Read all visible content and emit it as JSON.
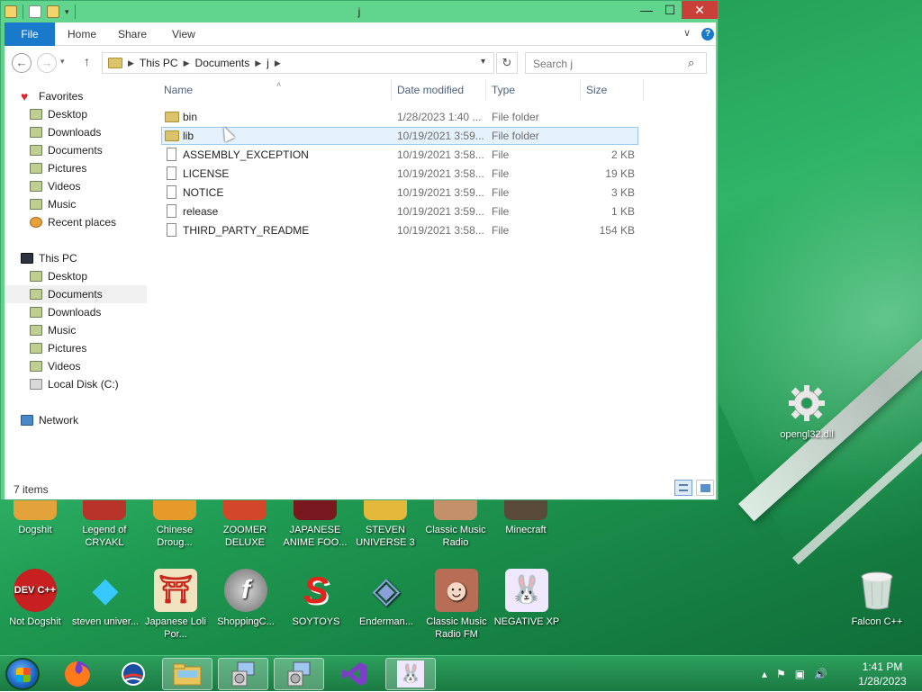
{
  "window": {
    "title": "j",
    "buttons": {
      "minimize": "—",
      "maximize": "☐",
      "close": "✕"
    }
  },
  "ribbon": {
    "tabs": [
      {
        "label": "File"
      },
      {
        "label": "Home"
      },
      {
        "label": "Share"
      },
      {
        "label": "View"
      }
    ],
    "help": "?",
    "collapse": "∨"
  },
  "nav": {
    "back": "←",
    "forward": "→",
    "recent": "▾",
    "up": "↑",
    "address": [
      "This PC",
      "Documents",
      "j"
    ],
    "dropdown": "▾",
    "refresh": "↻",
    "search_placeholder": "Search j",
    "search_icon": "⌕"
  },
  "sidebar": {
    "favorites": {
      "header": "Favorites",
      "items": [
        "Desktop",
        "Downloads",
        "Documents",
        "Pictures",
        "Videos",
        "Music",
        "Recent places"
      ]
    },
    "thispc": {
      "header": "This PC",
      "items": [
        "Desktop",
        "Documents",
        "Downloads",
        "Music",
        "Pictures",
        "Videos",
        "Local Disk (C:)"
      ]
    },
    "network": {
      "header": "Network"
    }
  },
  "columns": [
    "Name",
    "Date modified",
    "Type",
    "Size"
  ],
  "sort_arrow": "˄",
  "files": [
    {
      "name": "bin",
      "date": "1/28/2023 1:40 ...",
      "type": "File folder",
      "size": ""
    },
    {
      "name": "lib",
      "date": "10/19/2021 3:59...",
      "type": "File folder",
      "size": ""
    },
    {
      "name": "ASSEMBLY_EXCEPTION",
      "date": "10/19/2021 3:58...",
      "type": "File",
      "size": "2 KB"
    },
    {
      "name": "LICENSE",
      "date": "10/19/2021 3:58...",
      "type": "File",
      "size": "19 KB"
    },
    {
      "name": "NOTICE",
      "date": "10/19/2021 3:59...",
      "type": "File",
      "size": "3 KB"
    },
    {
      "name": "release",
      "date": "10/19/2021 3:59...",
      "type": "File",
      "size": "1 KB"
    },
    {
      "name": "THIRD_PARTY_README",
      "date": "10/19/2021 3:58...",
      "type": "File",
      "size": "154 KB"
    }
  ],
  "status": {
    "count": "7 items"
  },
  "desktop_icons": {
    "row1": [
      {
        "label": "Dogshit"
      },
      {
        "label": "Legend of CRYAKL"
      },
      {
        "label": "Chinese Droug..."
      },
      {
        "label": "ZOOMER DELUXE"
      },
      {
        "label": "JAPANESE ANIME FOO..."
      },
      {
        "label": "STEVEN UNIVERSE 3"
      },
      {
        "label": "Classic Music Radio"
      },
      {
        "label": "Minecraft"
      }
    ],
    "row2": [
      {
        "label": "Not Dogshit",
        "glyph": "DEV C++"
      },
      {
        "label": "steven univer...",
        "glyph": "◆"
      },
      {
        "label": "Japanese Loli Por...",
        "glyph": "⛩"
      },
      {
        "label": "ShoppingC...",
        "glyph": "f"
      },
      {
        "label": "SOYTOYS",
        "glyph": "S"
      },
      {
        "label": "Enderman...",
        "glyph": "◈"
      },
      {
        "label": "Classic Music Radio FM",
        "glyph": "☻"
      },
      {
        "label": "NEGATIVE XP",
        "glyph": "🐰"
      }
    ],
    "opengl": "opengl32.dll",
    "falcon": "Falcon C++"
  },
  "taskbar": {
    "tray_icons": {
      "chevron": "▴",
      "flag": "⚑",
      "network": "▣",
      "volume": "🔊"
    },
    "time": "1:41 PM",
    "date": "1/28/2023"
  },
  "colors": {
    "accent": "#1979ca",
    "window_frame": "#5fd38b",
    "close": "#c9403a",
    "selection": "#e5f1fb"
  }
}
